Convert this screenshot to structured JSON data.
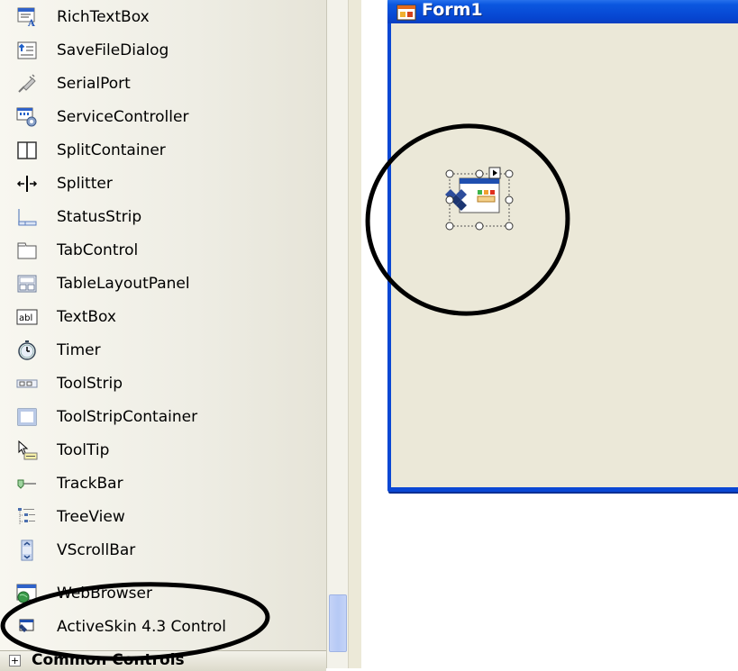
{
  "toolbox": {
    "items": [
      {
        "label": "RichTextBox",
        "icon": "richtextbox-icon"
      },
      {
        "label": "SaveFileDialog",
        "icon": "savefiledialog-icon"
      },
      {
        "label": "SerialPort",
        "icon": "serialport-icon"
      },
      {
        "label": "ServiceController",
        "icon": "servicecontroller-icon"
      },
      {
        "label": "SplitContainer",
        "icon": "splitcontainer-icon"
      },
      {
        "label": "Splitter",
        "icon": "splitter-icon"
      },
      {
        "label": "StatusStrip",
        "icon": "statusstrip-icon"
      },
      {
        "label": "TabControl",
        "icon": "tabcontrol-icon"
      },
      {
        "label": "TableLayoutPanel",
        "icon": "tablelayoutpanel-icon"
      },
      {
        "label": "TextBox",
        "icon": "textbox-icon"
      },
      {
        "label": "Timer",
        "icon": "timer-icon"
      },
      {
        "label": "ToolStrip",
        "icon": "toolstrip-icon"
      },
      {
        "label": "ToolStripContainer",
        "icon": "toolstripcontainer-icon"
      },
      {
        "label": "ToolTip",
        "icon": "tooltip-icon"
      },
      {
        "label": "TrackBar",
        "icon": "trackbar-icon"
      },
      {
        "label": "TreeView",
        "icon": "treeview-icon"
      },
      {
        "label": "VScrollBar",
        "icon": "vscrollbar-icon"
      },
      {
        "label": "WebBrowser",
        "icon": "webbrowser-icon"
      },
      {
        "label": "ActiveSkin 4.3 Control",
        "icon": "activeskin-control-icon"
      }
    ],
    "group_header": {
      "label": "Common Controls",
      "expander": "+"
    }
  },
  "designer": {
    "form_title": "Form1",
    "selected_component_icon": "activeskin-component-icon",
    "smart_tag_icon": "smart-tag-arrow-icon"
  },
  "colors": {
    "title_bar": "#0b57e0",
    "form_client": "#ebe8d8",
    "annotation_ink": "#000000"
  }
}
